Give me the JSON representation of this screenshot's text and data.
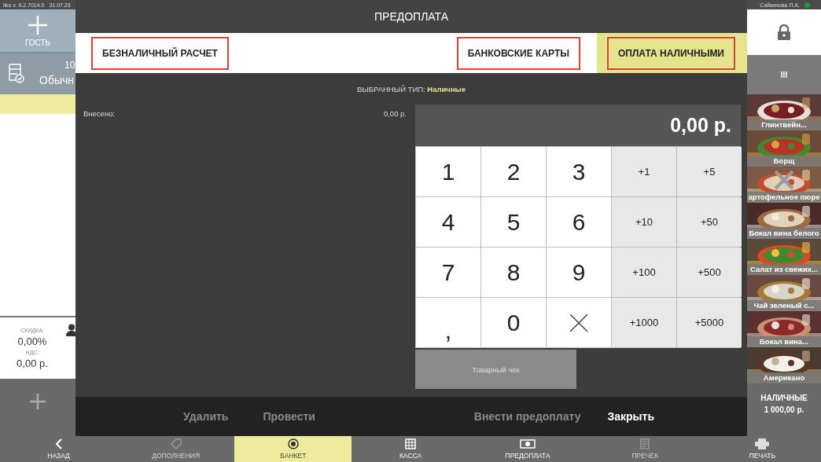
{
  "status_bar": {
    "version": "iiko  v. 9.2.7014.0",
    "date": "31.07.25",
    "user": "Сайкинова П.А.",
    "online": true
  },
  "left_panel": {
    "guest_button": "ГОСТЬ",
    "order": {
      "number": "10",
      "type": "Обычн"
    },
    "discount_label": "СКИДКА:",
    "discount": "0,00%",
    "vat_label": "НДС:",
    "vat": "0,00 р."
  },
  "right_panel": {
    "locked": true,
    "menu_button": "III",
    "items": [
      {
        "name": "Глинтвейн...",
        "stopped": false
      },
      {
        "name": "Борщ",
        "stopped": false
      },
      {
        "name": "артофельное пюре",
        "stopped": true
      },
      {
        "name": "Бокал вина белого",
        "stopped": false
      },
      {
        "name": "Салат из свежих...",
        "stopped": false
      },
      {
        "name": "Чай зеленый с...",
        "stopped": false
      },
      {
        "name": "Бокал вина...",
        "stopped": false
      },
      {
        "name": "Американо",
        "stopped": false
      }
    ],
    "payment": {
      "label": "НАЛИЧНЫЕ",
      "amount": "1 000,00 р."
    }
  },
  "bottom_nav": [
    {
      "label": "НАЗАД",
      "selected": false,
      "disabled": false
    },
    {
      "label": "ДОПОЛНЕНИЯ",
      "selected": false,
      "disabled": true
    },
    {
      "label": "БАНКЕТ",
      "selected": true,
      "disabled": false
    },
    {
      "label": "КАССА",
      "selected": false,
      "disabled": false
    },
    {
      "label": "ПРЕДОПЛАТА",
      "selected": false,
      "disabled": false
    },
    {
      "label": "ПРЕЧЕК",
      "selected": false,
      "disabled": true
    },
    {
      "label": "ПЕЧАТЬ",
      "selected": false,
      "disabled": false
    }
  ],
  "dialog": {
    "title": "ПРЕДОПЛАТА",
    "tabs": [
      {
        "label": "БЕЗНАЛИЧНЫЙ РАСЧЕТ",
        "selected": false,
        "highlighted": true
      },
      {
        "label": "БАНКОВСКИЕ КАРТЫ",
        "selected": false,
        "highlighted": true
      },
      {
        "label": "ОПЛАТА НАЛИЧНЫМИ",
        "selected": true,
        "highlighted": true
      }
    ],
    "selected_type_label": "ВЫБРАННЫЙ ТИП:",
    "selected_type": "Наличные",
    "paid_label": "Внесено:",
    "paid_amount": "0,00 р.",
    "display": "0,00 р.",
    "keys": [
      {
        "kind": "digit",
        "label": "1"
      },
      {
        "kind": "digit",
        "label": "2"
      },
      {
        "kind": "digit",
        "label": "3"
      },
      {
        "kind": "add",
        "label": "+1"
      },
      {
        "kind": "add",
        "label": "+5"
      },
      {
        "kind": "digit",
        "label": "4"
      },
      {
        "kind": "digit",
        "label": "5"
      },
      {
        "kind": "digit",
        "label": "6"
      },
      {
        "kind": "add",
        "label": "+10"
      },
      {
        "kind": "add",
        "label": "+50"
      },
      {
        "kind": "digit",
        "label": "7"
      },
      {
        "kind": "digit",
        "label": "8"
      },
      {
        "kind": "digit",
        "label": "9"
      },
      {
        "kind": "add",
        "label": "+100"
      },
      {
        "kind": "add",
        "label": "+500"
      },
      {
        "kind": "comma",
        "label": ","
      },
      {
        "kind": "digit",
        "label": "0"
      },
      {
        "kind": "backspace"
      },
      {
        "kind": "add",
        "label": "+1000"
      },
      {
        "kind": "add",
        "label": "+5000"
      }
    ],
    "receipt_button": {
      "label": "Товарный чек",
      "disabled": true
    },
    "actions": [
      {
        "label": "Удалить",
        "primary": false
      },
      {
        "label": "Провести",
        "primary": false
      },
      {
        "label": "Внести предоплату",
        "primary": false
      },
      {
        "label": "Закрыть",
        "primary": true
      }
    ]
  }
}
